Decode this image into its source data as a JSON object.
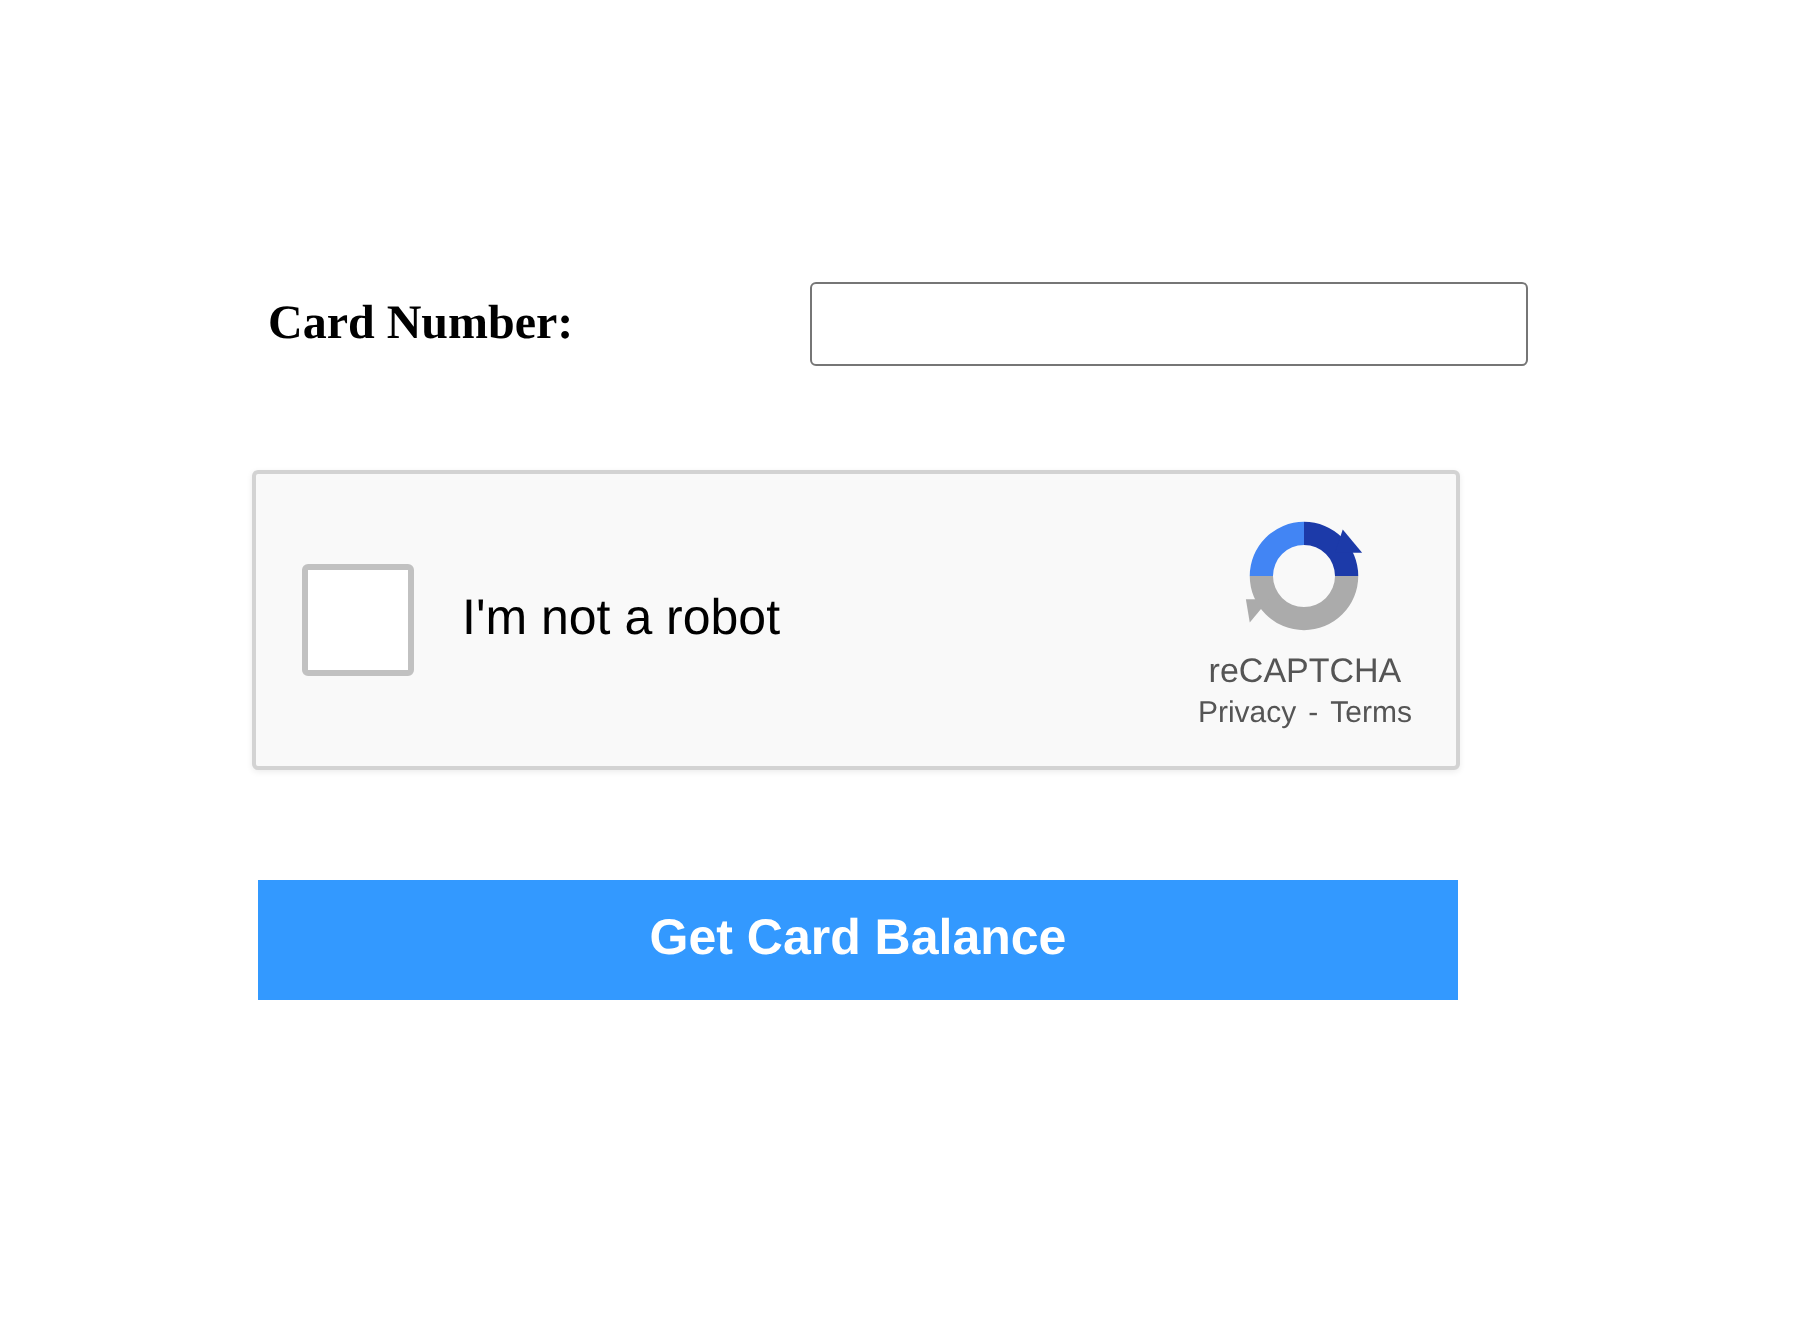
{
  "card_number": {
    "label": "Card Number:"
  },
  "captcha": {
    "label": "I'm not a robot",
    "checked": false,
    "brand": "reCAPTCHA",
    "links": [
      "Privacy",
      "Terms"
    ],
    "separator": "-"
  },
  "submit": {
    "label": "Get Card Balance"
  }
}
